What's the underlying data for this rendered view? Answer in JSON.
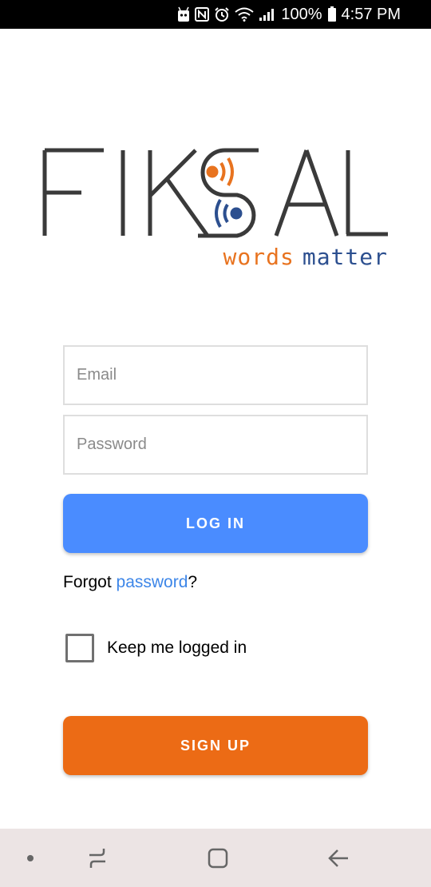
{
  "status_bar": {
    "battery_percent": "100%",
    "time": "4:57 PM",
    "icons": [
      "android-debug-icon",
      "nfc-icon",
      "alarm-icon",
      "wifi-icon",
      "signal-icon",
      "battery-icon"
    ]
  },
  "logo": {
    "wordmark": "FIKSAL",
    "tagline_words": "words",
    "tagline_matter": "matter",
    "colors": {
      "dark": "#3a3a3a",
      "orange": "#e8731f",
      "blue": "#2c4f8f"
    }
  },
  "login": {
    "email_placeholder": "Email",
    "email_value": "",
    "password_placeholder": "Password",
    "password_value": "",
    "login_label": "LOG IN",
    "forgot_prefix": "Forgot ",
    "forgot_link": "password",
    "forgot_suffix": "?",
    "keep_logged_in_label": "Keep me logged in",
    "keep_logged_in_checked": false,
    "signup_label": "SIGN UP"
  },
  "nav_bar": {
    "icons": [
      "nav-dot-icon",
      "recent-apps-icon",
      "home-icon",
      "back-icon"
    ]
  },
  "colors": {
    "login_button": "#4a8cff",
    "signup_button": "#ec6b15",
    "link": "#3d86e8",
    "nav_background": "#ece4e4"
  }
}
